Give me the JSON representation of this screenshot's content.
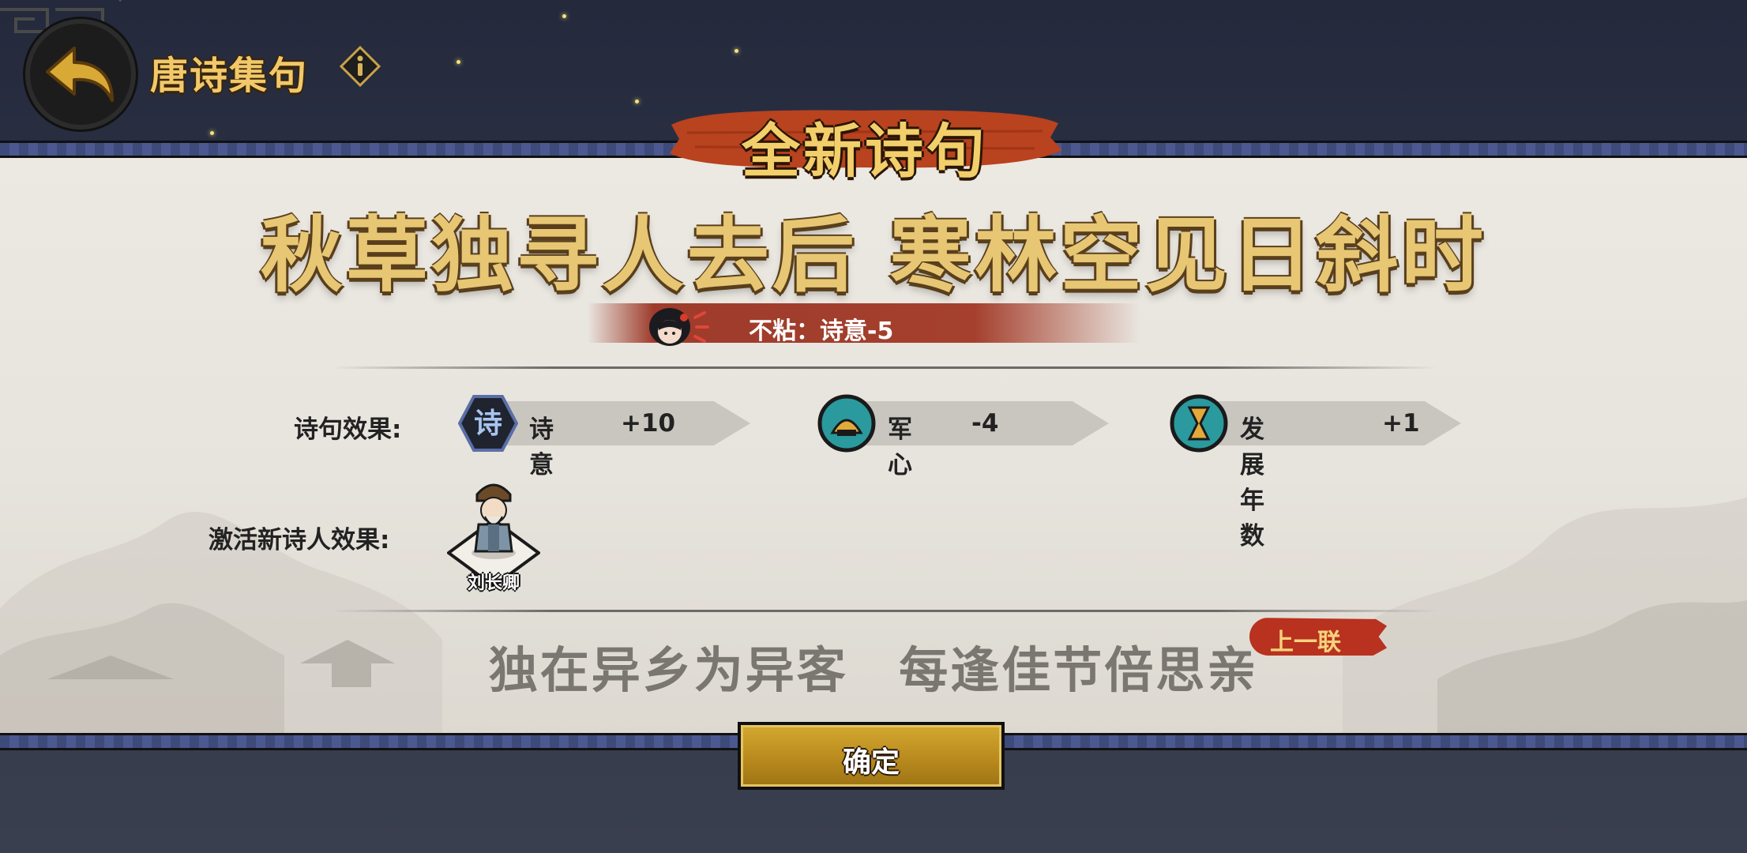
{
  "header": {
    "title": "唐诗集句",
    "back_icon": "back-arrow-icon",
    "info_icon": "info-icon"
  },
  "banner": {
    "label": "全新诗句"
  },
  "poem": {
    "current_line": "秋草独寻人去后 寒林空见日斜时",
    "previous_line": "独在异乡为异客   每逢佳节倍思亲",
    "previous_tag": "上一联"
  },
  "penalty": {
    "text": "不粘：诗意-5",
    "icon": "girl-character-icon"
  },
  "effects": {
    "label": "诗句效果:",
    "items": [
      {
        "icon": "poetry-icon",
        "icon_char": "诗",
        "name": "诗意",
        "value": "+10"
      },
      {
        "icon": "army-morale-icon",
        "name": "军心",
        "value": "-4"
      },
      {
        "icon": "hourglass-icon",
        "name": "发展年数",
        "value": "+1"
      }
    ]
  },
  "activate": {
    "label": "激活新诗人效果:",
    "poet_name": "刘长卿"
  },
  "confirm": {
    "label": "确定"
  },
  "colors": {
    "gold": "#f1c96a",
    "panel": "#e9e6e0",
    "red_tag": "#b8321f",
    "border_blue": "#3d4a7a"
  }
}
